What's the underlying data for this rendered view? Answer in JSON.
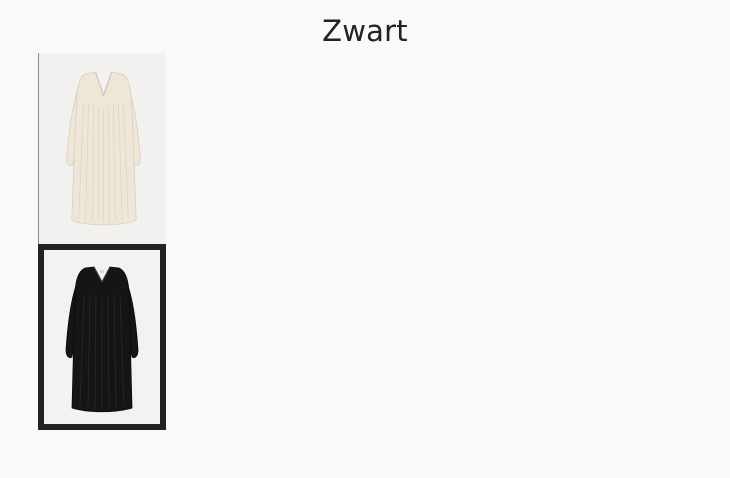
{
  "product": {
    "selected_color_label": "Zwart"
  },
  "color_options": [
    {
      "name": "cream-knit-dress",
      "color": "#efe9dc",
      "selected": false
    },
    {
      "name": "black-knit-dress",
      "color": "#111111",
      "selected": true
    }
  ],
  "colors": {
    "page_background": "#faf9f8",
    "selected_border": "#222222",
    "text": "#222222"
  }
}
